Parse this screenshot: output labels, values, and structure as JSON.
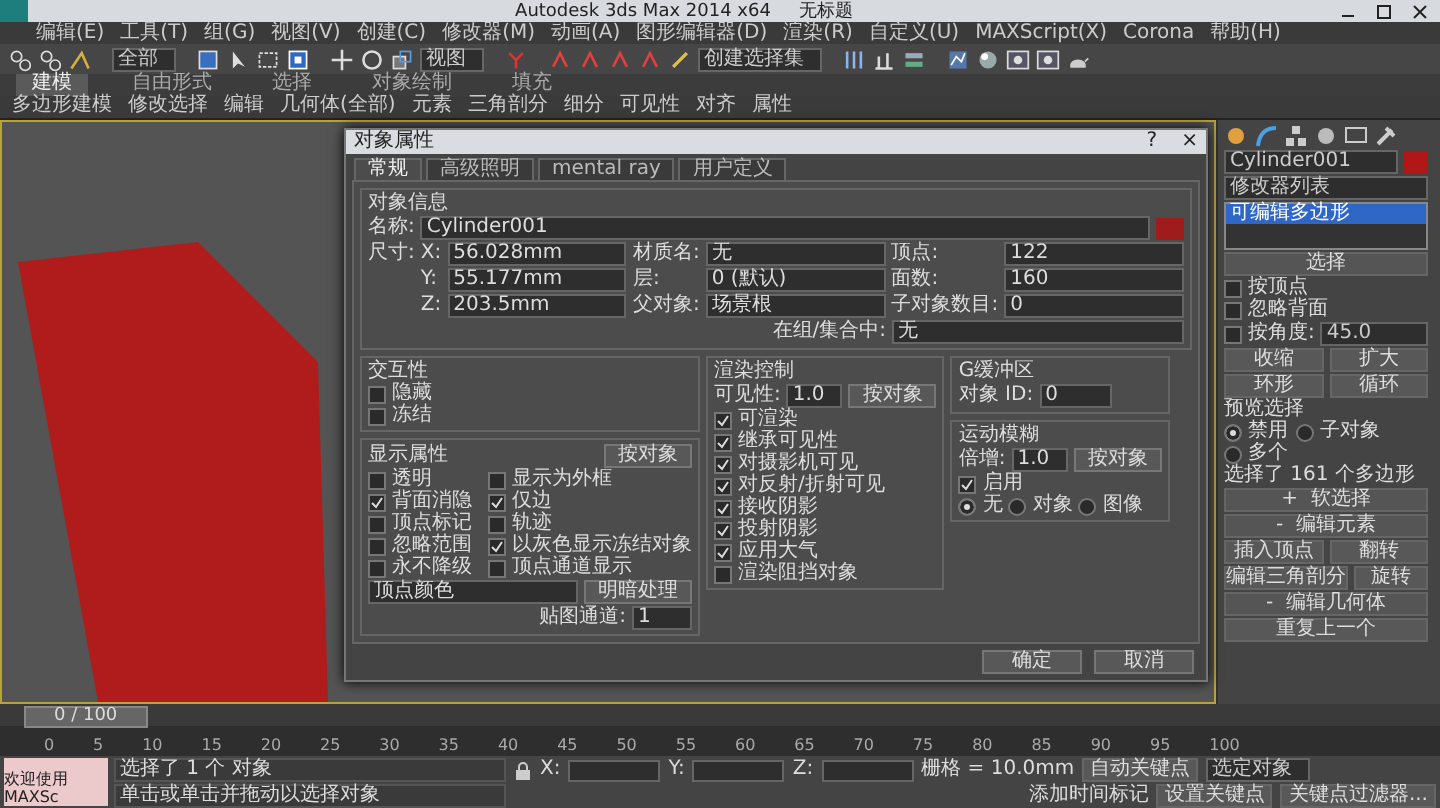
{
  "window": {
    "title": "Autodesk 3ds Max 2014 x64",
    "document": "无标题"
  },
  "menu": [
    "编辑(E)",
    "工具(T)",
    "组(G)",
    "视图(V)",
    "创建(C)",
    "修改器(M)",
    "动画(A)",
    "图形编辑器(D)",
    "渲染(R)",
    "自定义(U)",
    "MAXScript(X)",
    "Corona",
    "帮助(H)"
  ],
  "toolbar": {
    "selection_filter": "全部",
    "reference_coord": "视图",
    "named_selection": "创建选择集"
  },
  "ribbon_tabs": [
    {
      "label": "建模",
      "selected": true
    },
    {
      "label": "自由形式",
      "selected": false
    },
    {
      "label": "选择",
      "selected": false
    },
    {
      "label": "对象绘制",
      "selected": false
    },
    {
      "label": "填充",
      "selected": false
    }
  ],
  "ribbon_groups": [
    "多边形建模",
    "修改选择",
    "编辑",
    "几何体(全部)",
    "元素",
    "三角剖分",
    "细分",
    "可见性",
    "对齐",
    "属性"
  ],
  "dialog": {
    "title": "对象属性",
    "help": "?",
    "close": "×",
    "tabs": [
      {
        "label": "常规",
        "selected": true
      },
      {
        "label": "高级照明",
        "selected": false
      },
      {
        "label": "mental ray",
        "selected": false
      },
      {
        "label": "用户定义",
        "selected": false
      }
    ],
    "object_info": {
      "title": "对象信息",
      "name_label": "名称:",
      "name": "Cylinder001",
      "color": "#a01c1c",
      "dims_label": "尺寸:",
      "dims": [
        {
          "axis": "X:",
          "value": "56.028mm"
        },
        {
          "axis": "Y:",
          "value": "55.177mm"
        },
        {
          "axis": "Z:",
          "value": "203.5mm"
        }
      ],
      "right_fields": [
        {
          "label": "材质名:",
          "value": "无"
        },
        {
          "label": "层:",
          "value": "0 (默认)"
        }
      ],
      "counts": [
        {
          "label": "顶点:",
          "value": "122"
        },
        {
          "label": "面数:",
          "value": "160"
        }
      ],
      "parent_fields": [
        {
          "label": "父对象:",
          "value": "场景根"
        },
        {
          "label": "子对象数目:",
          "value": "0"
        }
      ],
      "group": {
        "label": "在组/集合中:",
        "value": "无"
      }
    },
    "interactivity": {
      "title": "交互性",
      "options": [
        {
          "label": "隐藏",
          "checked": false
        },
        {
          "label": "冻结",
          "checked": false
        }
      ]
    },
    "display": {
      "title": "显示属性",
      "button": "按对象",
      "options": [
        {
          "label": "透明",
          "checked": false
        },
        {
          "label": "显示为外框",
          "checked": false
        },
        {
          "label": "背面消隐",
          "checked": true
        },
        {
          "label": "仅边",
          "checked": true
        },
        {
          "label": "顶点标记",
          "checked": false
        },
        {
          "label": "轨迹",
          "checked": false
        },
        {
          "label": "忽略范围",
          "checked": false
        },
        {
          "label": "以灰色显示冻结对象",
          "checked": true
        },
        {
          "label": "永不降级",
          "checked": false
        },
        {
          "label": "顶点通道显示",
          "checked": false
        }
      ],
      "shading_mode": "顶点颜色",
      "shaded_button": "明暗处理",
      "map_channel_label": "贴图通道:",
      "map_channel": "1"
    },
    "render": {
      "title": "渲染控制",
      "visibility_label": "可见性:",
      "visibility": "1.0",
      "button": "按对象",
      "options": [
        {
          "label": "可渲染",
          "checked": true
        },
        {
          "label": "继承可见性",
          "checked": true
        },
        {
          "label": "对摄影机可见",
          "checked": true
        },
        {
          "label": "对反射/折射可见",
          "checked": true
        },
        {
          "label": "接收阴影",
          "checked": true
        },
        {
          "label": "投射阴影",
          "checked": true
        },
        {
          "label": "应用大气",
          "checked": true
        },
        {
          "label": "渲染阻挡对象",
          "checked": false
        }
      ]
    },
    "gbuffer": {
      "title": "G缓冲区",
      "label": "对象 ID:",
      "value": "0"
    },
    "motion_blur": {
      "title": "运动模糊",
      "multiplier_label": "倍增:",
      "multiplier": "1.0",
      "button": "按对象",
      "enabled": {
        "label": "启用",
        "checked": true
      },
      "types": [
        {
          "label": "无",
          "selected": true
        },
        {
          "label": "对象",
          "selected": false
        },
        {
          "label": "图像",
          "selected": false
        }
      ]
    },
    "buttons": [
      "确定",
      "取消"
    ]
  },
  "command_panel": {
    "object": {
      "name": "Cylinder001",
      "color": "#b01818"
    },
    "modifier_list": "修改器列表",
    "stack": [
      {
        "label": "可编辑多边形",
        "selected": true
      }
    ],
    "rollout_title": "选择",
    "options": [
      {
        "label": "按顶点",
        "checked": false
      },
      {
        "label": "忽略背面",
        "checked": false
      },
      {
        "label": "按角度:",
        "checked": false
      }
    ],
    "angle": "45.0",
    "buttons_a": [
      "收缩",
      "扩大"
    ],
    "buttons_b": [
      "环形",
      "循环"
    ],
    "preview_label": "预览选择",
    "preview": [
      {
        "label": "禁用",
        "selected": true
      },
      {
        "label": "子对象",
        "selected": false
      },
      {
        "label": "多个",
        "selected": false
      }
    ],
    "selection_info": "选择了 161 个多边形",
    "sections": [
      {
        "label": "软选择",
        "sign": "+"
      },
      {
        "label": "编辑元素",
        "sign": "-"
      }
    ],
    "element_buttons": [
      "插入顶点",
      "翻转",
      "编辑三角剖分",
      "旋转"
    ],
    "sections_b": [
      {
        "label": "编辑几何体",
        "sign": "-"
      }
    ],
    "repeat_button": "重复上一个"
  },
  "timeline": {
    "frame": "0 / 100",
    "ticks": [
      "0",
      "5",
      "10",
      "15",
      "20",
      "25",
      "30",
      "35",
      "40",
      "45",
      "50",
      "55",
      "60",
      "65",
      "70",
      "75",
      "80",
      "85",
      "90",
      "95",
      "100"
    ]
  },
  "status": {
    "script_label": "欢迎使用 MAXSc",
    "selection": "选择了 1 个 对象",
    "prompt": "单击或单击并拖动以选择对象",
    "x_label": "X:",
    "y_label": "Y:",
    "z_label": "Z:",
    "grid": "栅格 = 10.0mm",
    "time_tag": "添加时间标记",
    "auto_key": "自动关键点",
    "set_key": "设置关键点",
    "key_target": "选定对象",
    "key_filters": "关键点过滤器..."
  }
}
